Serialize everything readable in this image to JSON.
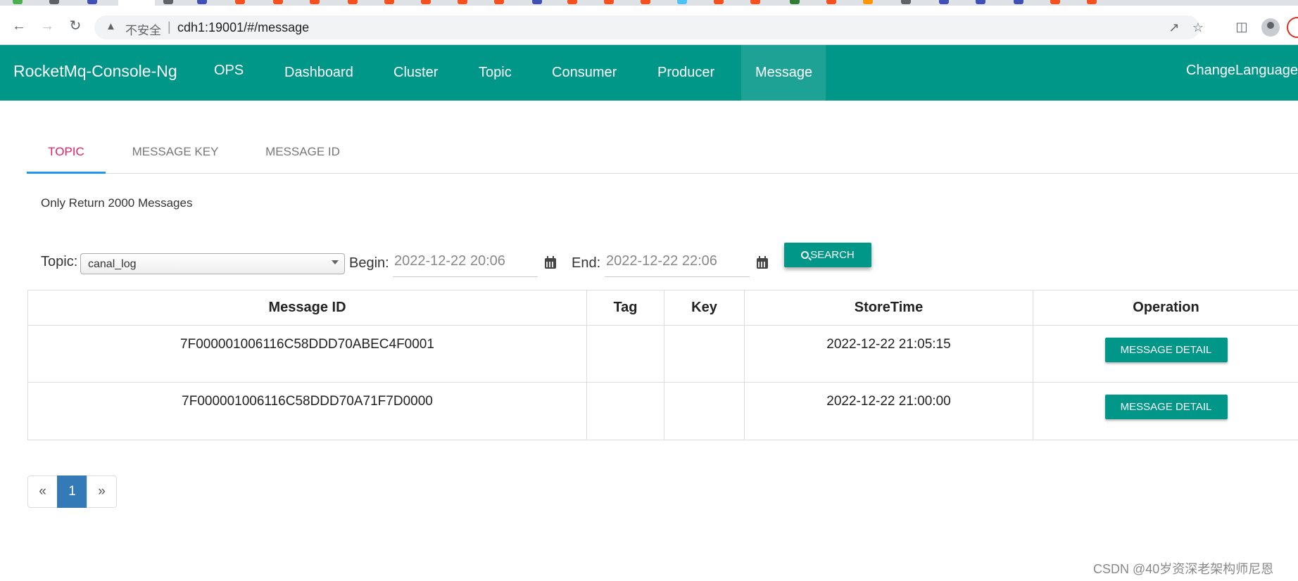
{
  "browser": {
    "insecure_label": "不安全",
    "separator": "|",
    "url": "cdh1:19001/#/message"
  },
  "navbar": {
    "brand": "RocketMq-Console-Ng",
    "items": [
      "OPS",
      "Dashboard",
      "Cluster",
      "Topic",
      "Consumer",
      "Producer",
      "Message"
    ],
    "active": "Message",
    "change_language": "ChangeLanguage"
  },
  "query_tabs": {
    "items": [
      "TOPIC",
      "MESSAGE KEY",
      "MESSAGE ID"
    ],
    "active": "TOPIC"
  },
  "notice": "Only Return 2000 Messages",
  "filter": {
    "topic_label": "Topic:",
    "topic_value": "canal_log",
    "begin_label": "Begin:",
    "begin_value": "2022-12-22 20:06",
    "end_label": "End:",
    "end_value": "2022-12-22 22:06",
    "search_label": "SEARCH"
  },
  "table": {
    "headers": [
      "Message ID",
      "Tag",
      "Key",
      "StoreTime",
      "Operation"
    ],
    "rows": [
      {
        "message_id": "7F000001006116C58DDD70ABEC4F0001",
        "tag": "",
        "key": "",
        "store_time": "2022-12-22 21:05:15",
        "operation": "MESSAGE DETAIL"
      },
      {
        "message_id": "7F000001006116C58DDD70A71F7D0000",
        "tag": "",
        "key": "",
        "store_time": "2022-12-22 21:00:00",
        "operation": "MESSAGE DETAIL"
      }
    ]
  },
  "pagination": {
    "prev": "«",
    "current": "1",
    "next": "»"
  },
  "watermark": "CSDN @40岁资深老架构师尼恩",
  "colors": {
    "primary": "#009688",
    "active_tab_text": "#e91e63",
    "active_tab_underline": "#2196f3",
    "pager_active": "#337ab7"
  }
}
